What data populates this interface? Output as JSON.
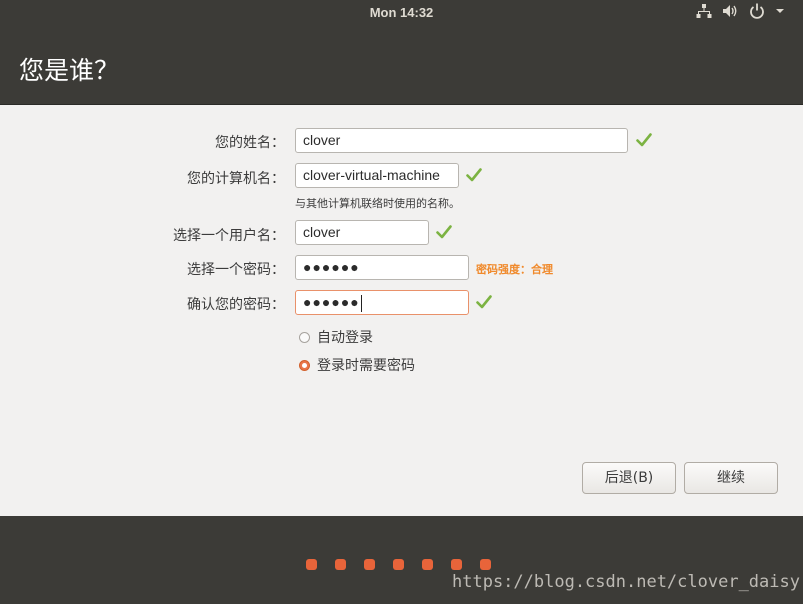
{
  "topbar": {
    "clock": "Mon 14:32",
    "icons": [
      "network-icon",
      "volume-icon",
      "power-icon",
      "chevron-down-icon"
    ]
  },
  "header": {
    "title": "您是谁？"
  },
  "form": {
    "name": {
      "label": "您的姓名：",
      "value": "clover"
    },
    "computer": {
      "label": "您的计算机名：",
      "value": "clover-virtual-machine",
      "hint": "与其他计算机联络时使用的名称。"
    },
    "username": {
      "label": "选择一个用户名：",
      "value": "clover"
    },
    "password": {
      "label": "选择一个密码：",
      "value": "●●●●●●",
      "strength": "密码强度：合理"
    },
    "confirm": {
      "label": "确认您的密码：",
      "value": "●●●●●●"
    },
    "login_options": [
      {
        "label": "自动登录",
        "selected": false
      },
      {
        "label": "登录时需要密码",
        "selected": true
      }
    ]
  },
  "buttons": {
    "back": "后退(B)",
    "continue": "继续"
  },
  "progress": {
    "steps_shown": 7
  },
  "watermark": "https://blog.csdn.net/clover_daisy",
  "colors": {
    "accent": "#e8643a",
    "check": "#7cb342",
    "strength": "#f08a2c",
    "panel": "#3c3b37"
  }
}
